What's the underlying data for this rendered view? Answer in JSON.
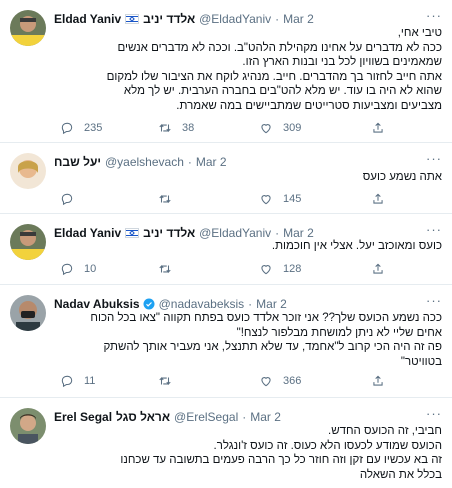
{
  "colors": {
    "name": "#0f1419",
    "muted": "#5b7083",
    "verified": "#1da1f2",
    "divider": "#e6ecf0"
  },
  "tweets": [
    {
      "name": "Eldad Yaniv",
      "hebrew_name": "אלדד יניב",
      "handle": "@EldadYaniv",
      "separator": "·",
      "date": "Mar 2",
      "flag_icon": "israel-flag-icon",
      "avatar_caption": "",
      "lines": [
        "טיבי אחי,",
        "ככה לא מדברים על אחינו מקהילת הלהט\"ב. וככה לא מדברים אנשים",
        "שמאמינים בשוויון לכל בני ובנות הארץ הזו.",
        "אתה חייב לחזור בך מהדברים. חייב. מנהיג לוקח את הציבור שלו למקום",
        "שהוא לא היה בו עוד. יש מלא להט\"בים בחברה הערבית. יש לך מלא",
        "מצביעים ומצביעות סטרייטים שמתביישים במה שאמרת."
      ],
      "replies": "235",
      "retweets": "38",
      "likes": "309"
    },
    {
      "name": "",
      "hebrew_name": "יעל שבח",
      "handle": "@yaelshevach",
      "separator": "·",
      "date": "Mar 2",
      "lines": [
        "אתה נשמע כועס"
      ],
      "replies": "",
      "retweets": "",
      "likes": "145"
    },
    {
      "name": "Eldad Yaniv",
      "hebrew_name": "אלדד יניב",
      "handle": "@EldadYaniv",
      "separator": "·",
      "date": "Mar 2",
      "flag_icon": "israel-flag-icon",
      "lines": [
        "כועס ומאוכזב יעל. אצלי אין חוכמות."
      ],
      "replies": "10",
      "retweets": "",
      "likes": "128"
    },
    {
      "name": "Nadav Abuksis",
      "hebrew_name": "",
      "handle": "@nadavabeksis",
      "separator": "·",
      "date": "Mar 2",
      "verified_icon": "verified-badge-icon",
      "lines": [
        "ככה נשמע הכועס שלך?? אני זוכר אלדד כועס בפתח תקווה \"צאו בכל הכוח",
        "אחים שליי לא ניתן למושחת מבלפור לנצח!\"",
        "פה זה היה הכי קרוב ל\"אחמד, עד שלא תתנצל, אני מעביר אותך להשתק",
        "בטוויטר\""
      ],
      "replies": "11",
      "retweets": "",
      "likes": "366"
    },
    {
      "name": "Erel Segal",
      "hebrew_name": "אראל סגל",
      "handle": "@ErelSegal",
      "separator": "·",
      "date": "Mar 2",
      "lines": [
        "חביבי, זה הכועס החדש.",
        "הכועס שמודע לכעסו הלא כעוס. זה כועס ז'ונגלר.",
        "זה בא עכשיו עם זקן וזה חוזר כל כך הרבה פעמים בתשובה עד שכחנו",
        "בכלל את השאלה"
      ]
    }
  ]
}
